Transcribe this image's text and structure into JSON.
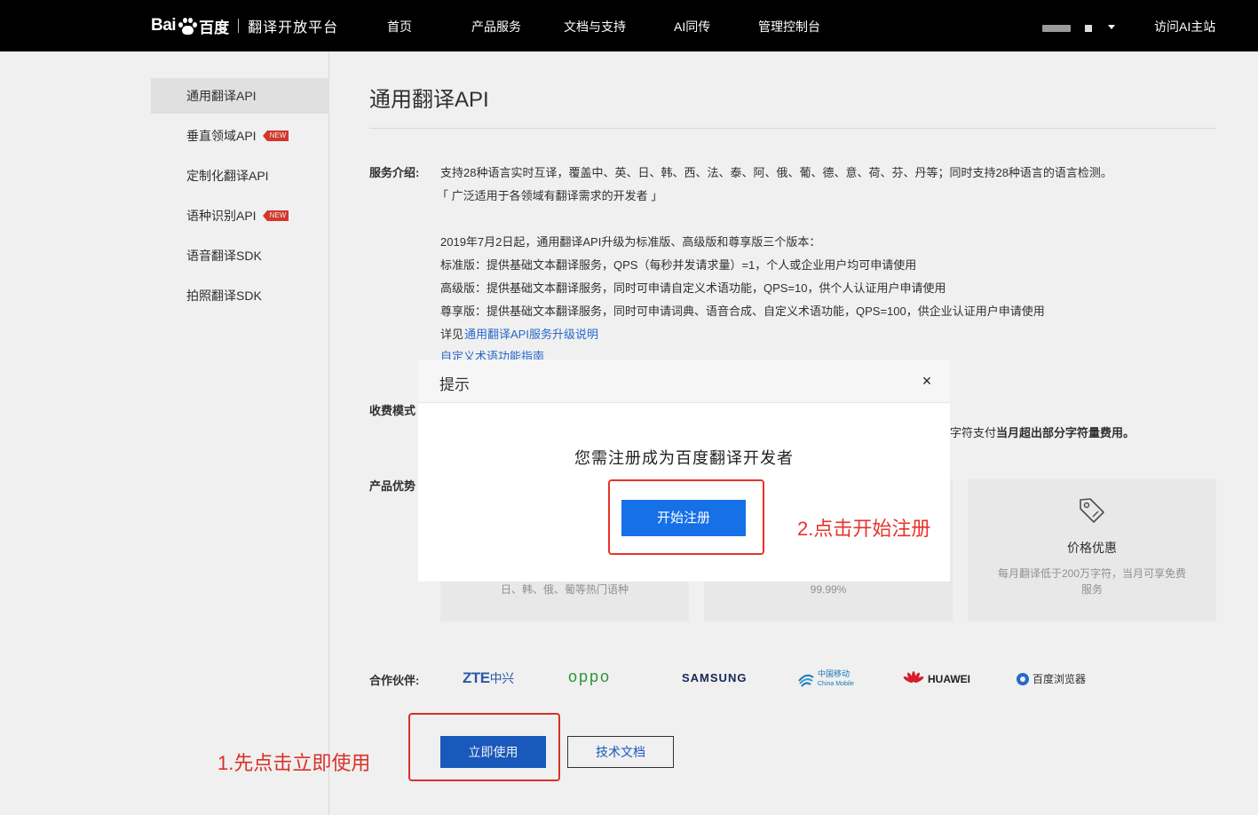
{
  "header": {
    "logo_bai": "Bai",
    "logo_du_cn": "百度",
    "platform_name": "翻译开放平台",
    "nav": [
      "首页",
      "产品服务",
      "文档与支持",
      "AI同传",
      "管理控制台"
    ],
    "visit_link": "访问AI主站"
  },
  "sidebar": {
    "items": [
      {
        "label": "通用翻译API",
        "active": true,
        "badge": ""
      },
      {
        "label": "垂直领域API",
        "active": false,
        "badge": "NEW"
      },
      {
        "label": "定制化翻译API",
        "active": false,
        "badge": ""
      },
      {
        "label": "语种识别API",
        "active": false,
        "badge": "NEW"
      },
      {
        "label": "语音翻译SDK",
        "active": false,
        "badge": ""
      },
      {
        "label": "拍照翻译SDK",
        "active": false,
        "badge": ""
      }
    ]
  },
  "main": {
    "title": "通用翻译API",
    "service_intro_label": "服务介绍:",
    "service_lines": [
      "支持28种语言实时互译，覆盖中、英、日、韩、西、法、泰、阿、俄、葡、德、意、荷、芬、丹等；同时支持28种语言的语言检测。",
      "「 广泛适用于各领域有翻译需求的开发者 」"
    ],
    "upgrade_lines": [
      "2019年7月2日起，通用翻译API升级为标准版、高级版和尊享版三个版本：",
      "标准版：提供基础文本翻译服务，QPS（每秒并发请求量）=1，个人或企业用户均可申请使用",
      "高级版：提供基础文本翻译服务，同时可申请自定义术语功能，QPS=10，供个人认证用户申请使用",
      "尊享版：提供基础文本翻译服务，同时可申请词典、语音合成、自定义术语功能，QPS=100，供企业认证用户申请使用"
    ],
    "detail_prefix": "详见",
    "detail_link": "通用翻译API服务升级说明",
    "term_guide_link": "自定义术语功能指南",
    "billing_label": "收费模式",
    "billing_tail_normal": "字符支付",
    "billing_tail_bold": "当月超出部分字符量费用。",
    "advantages_label": "产品优势",
    "card1_desc": "日、韩、俄、葡等热门语种",
    "card2_desc": "99.99%",
    "card3_title": "价格优惠",
    "card3_desc": "每月翻译低于200万字符，当月可享免费服务",
    "partners_label": "合作伙伴:",
    "partners": {
      "zte": "ZTE",
      "zte_cn": "中兴",
      "oppo": "oppo",
      "samsung": "SAMSUNG",
      "cmcc_cn": "中国移动",
      "cmcc_en": "China Mobile",
      "huawei": "HUAWEI",
      "baidu_browser": "百度浏览器"
    },
    "use_now_button": "立即使用",
    "tech_docs_button": "技术文档"
  },
  "annotations": {
    "step1": "1.先点击立即使用",
    "step2": "2.点击开始注册",
    "color": "#e8332b"
  },
  "modal": {
    "title": "提示",
    "close_icon": "×",
    "message": "您需注册成为百度翻译开发者",
    "register_button": "开始注册"
  }
}
